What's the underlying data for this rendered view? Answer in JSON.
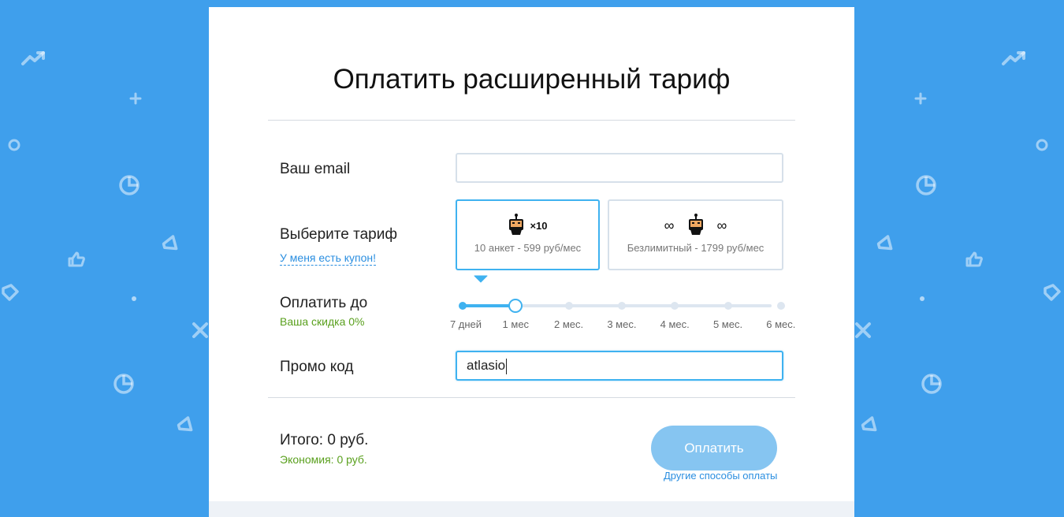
{
  "page": {
    "title": "Оплатить расширенный тариф"
  },
  "form": {
    "email_label": "Ваш email",
    "email_value": "",
    "plan_label": "Выберите тариф",
    "coupon_link": "У меня есть купон!",
    "plans": [
      {
        "badge": "×10",
        "description": "10 анкет - 599 руб/мес",
        "selected": true
      },
      {
        "badge_left": "∞",
        "badge_right": "∞",
        "description": "Безлимитный - 1799 руб/мес",
        "selected": false
      }
    ],
    "period_label": "Оплатить до",
    "discount": "Ваша скидка 0%",
    "period_options": [
      "7 дней",
      "1 мес",
      "2 мес.",
      "3 мес.",
      "4 мес.",
      "5 мес.",
      "6 мес."
    ],
    "period_selected_index": 1,
    "promo_label": "Промо код",
    "promo_value": "atlasio"
  },
  "summary": {
    "total": "Итого: 0 руб.",
    "savings": "Экономия: 0 руб.",
    "pay_button": "Оплатить",
    "other_methods": "Другие способы оплаты"
  },
  "colors": {
    "background": "#3f9fec",
    "accent": "#3fb2f0",
    "green": "#5aa01e",
    "pay_button": "#86c5f1"
  },
  "decor_icons": [
    "trend-up-icon",
    "plus-icon",
    "circle-icon",
    "pie-chart-icon",
    "megaphone-icon",
    "thumbs-up-icon",
    "tag-icon",
    "dot-icon",
    "close-x-icon"
  ]
}
